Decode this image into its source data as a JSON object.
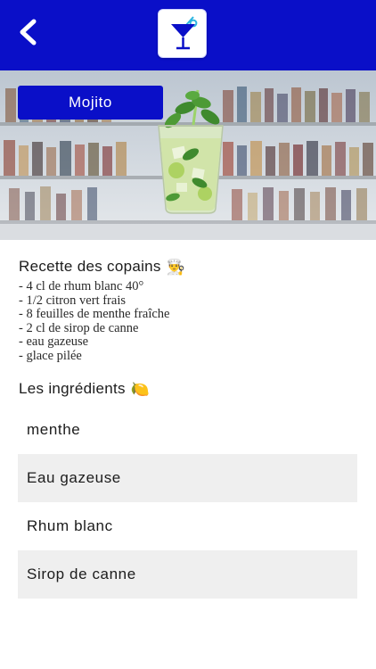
{
  "header": {
    "back_icon": "chevron-left-icon",
    "logo_icon": "cocktail-glass-icon",
    "accent_color": "#0a0fc8"
  },
  "cocktail": {
    "name": "Mojito"
  },
  "recipe": {
    "title": "Recette des copains",
    "title_emoji": "👨‍🍳",
    "lines": [
      "- 4 cl de rhum blanc 40°",
      "- 1/2 citron vert frais",
      "- 8 feuilles de menthe fraîche",
      "- 2 cl de sirop de canne",
      "- eau gazeuse",
      "- glace pilée"
    ]
  },
  "ingredients": {
    "title": "Les ingrédients",
    "title_emoji": "🍋",
    "items": [
      "menthe",
      "Eau gazeuse",
      "Rhum blanc",
      "Sirop de canne"
    ]
  }
}
